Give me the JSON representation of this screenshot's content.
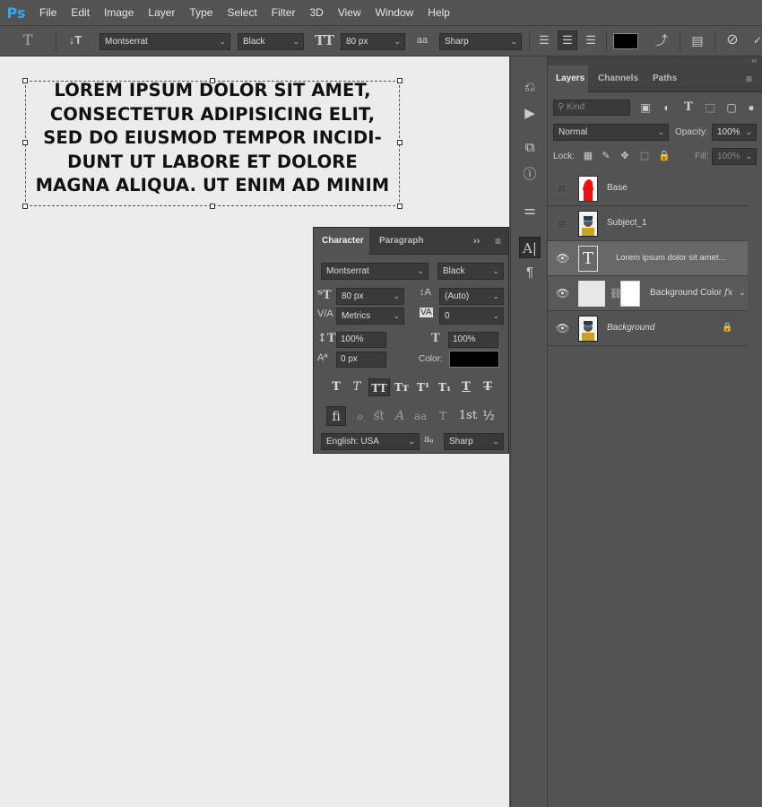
{
  "app": {
    "logo": "Ps"
  },
  "menu": [
    "File",
    "Edit",
    "Image",
    "Layer",
    "Type",
    "Select",
    "Filter",
    "3D",
    "View",
    "Window",
    "Help"
  ],
  "options": {
    "font_family": "Montserrat",
    "font_style": "Black",
    "font_size": "80 px",
    "antialias_icon": "aa-icon",
    "antialias": "Sharp",
    "text_color": "#000000"
  },
  "canvas": {
    "lines": [
      "LOREM IPSUM DOLOR SIT AMET,",
      "CONSECTETUR ADIPISICING ELIT,",
      "SED DO EIUSMOD TEMPOR INCIDI-",
      "DUNT UT LABORE ET DOLORE",
      "MAGNA ALIQUA. UT ENIM AD MINIM"
    ],
    "background": "#ececec"
  },
  "character_panel": {
    "tabs": [
      "Character",
      "Paragraph"
    ],
    "font_family": "Montserrat",
    "font_style": "Black",
    "font_size": "80 px",
    "leading": "(Auto)",
    "kerning": "Metrics",
    "tracking": "0",
    "vertical_scale": "100%",
    "horizontal_scale": "100%",
    "baseline_shift": "0 px",
    "color_label": "Color:",
    "color": "#000000",
    "language": "English: USA",
    "aa_label": "aₐ",
    "antialias": "Sharp",
    "ordinal": "1st",
    "fraction": "½"
  },
  "layers_panel": {
    "tabs": [
      "Layers",
      "Channels",
      "Paths"
    ],
    "kind": "Kind",
    "blend_mode": "Normal",
    "opacity_label": "Opacity:",
    "opacity": "100%",
    "lock_label": "Lock:",
    "fill_label": "Fill:",
    "fill": "100%",
    "layers": [
      {
        "name": "Base",
        "visible": false
      },
      {
        "name": "Subject_1",
        "visible": false
      },
      {
        "name": "Lorem ipsum dolor sit amet...",
        "visible": true,
        "selected": true
      },
      {
        "name": "Background Color",
        "visible": true,
        "fx": "fx"
      },
      {
        "name": "Background",
        "visible": true,
        "locked": true
      }
    ]
  }
}
